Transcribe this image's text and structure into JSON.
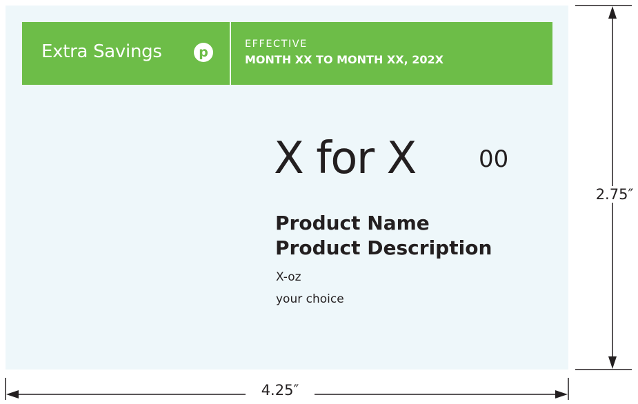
{
  "sign": {
    "brand": "Extra Savings",
    "badge_letter": "p",
    "effective_label": "EFFECTIVE",
    "effective_dates": "MONTH XX TO MONTH XX, 202X",
    "price_main": "X for X",
    "price_cents": "00",
    "product_name": "Product Name",
    "product_description": "Product Description",
    "size": "X-oz",
    "choice": "your choice"
  },
  "dimensions": {
    "width": "4.25″",
    "height": "2.75″"
  },
  "colors": {
    "banner": "#6dbd48",
    "card": "#eef7fa",
    "text": "#231f20"
  }
}
